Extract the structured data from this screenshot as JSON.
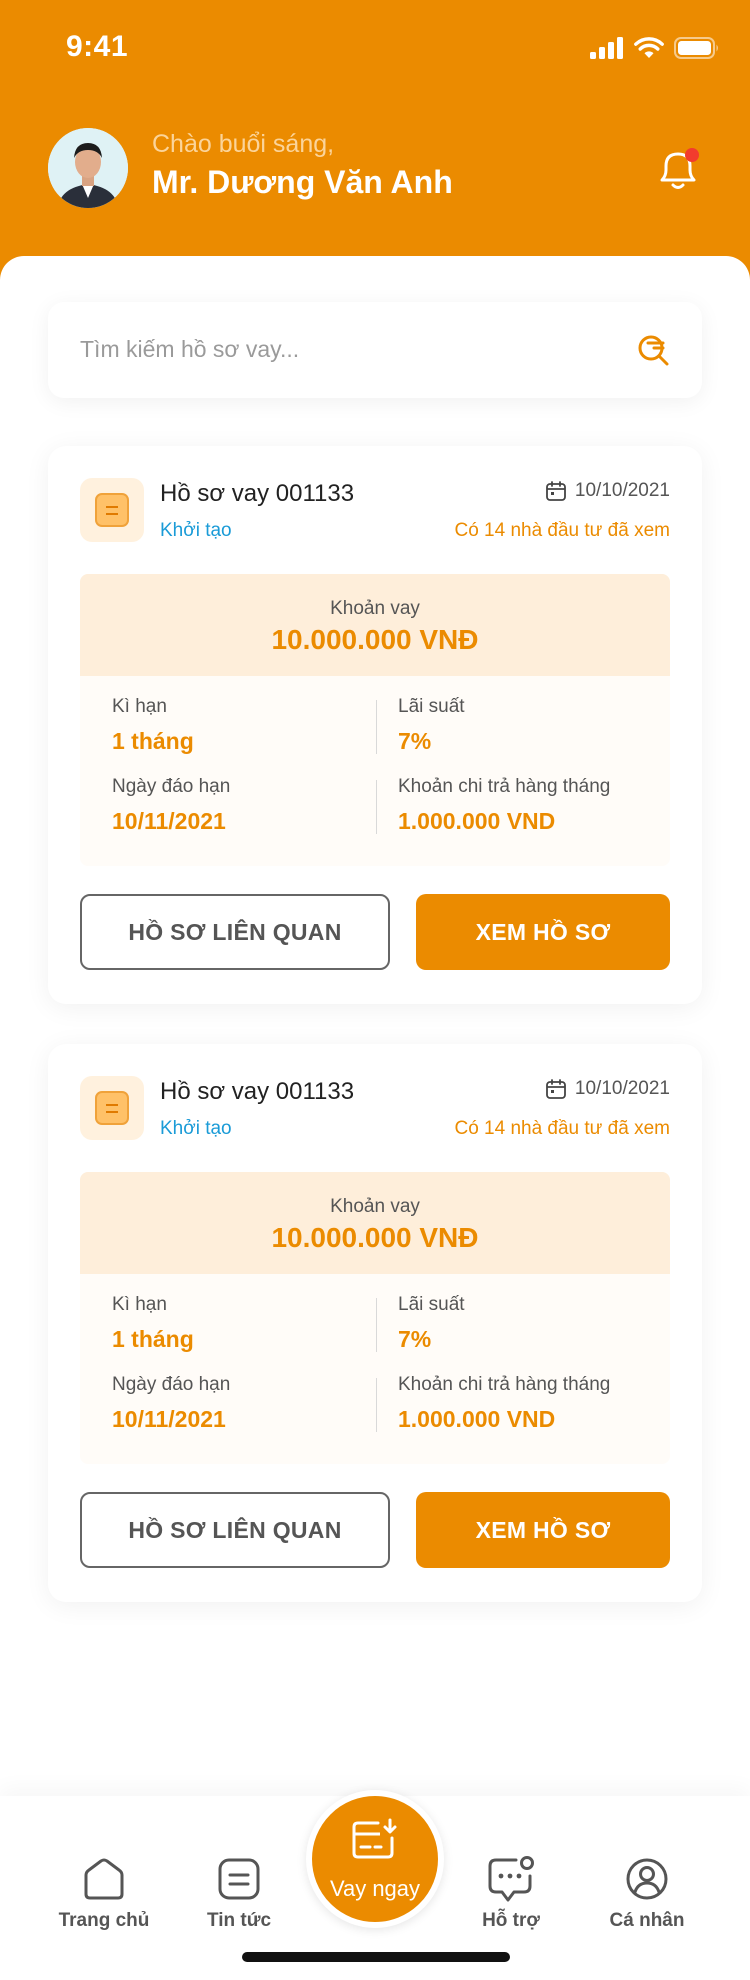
{
  "status_bar": {
    "time": "9:41"
  },
  "header": {
    "greeting": "Chào buổi sáng,",
    "user_name": "Mr. Dương Văn Anh"
  },
  "search": {
    "placeholder": "Tìm kiếm hồ sơ vay..."
  },
  "cards": [
    {
      "title": "Hồ sơ vay 001133",
      "status": "Khởi tạo",
      "date": "10/10/2021",
      "viewers": "Có 14 nhà đầu tư đã xem",
      "loan_label": "Khoản vay",
      "loan_amount": "10.000.000 VNĐ",
      "term_label": "Kì hạn",
      "term_value": "1 tháng",
      "rate_label": "Lãi suất",
      "rate_value": "7%",
      "maturity_label": "Ngày đáo hạn",
      "maturity_value": "10/11/2021",
      "monthly_label": "Khoản chi trả hàng tháng",
      "monthly_value": "1.000.000 VND",
      "related_button": "HỒ SƠ LIÊN QUAN",
      "view_button": "XEM HỒ SƠ"
    },
    {
      "title": "Hồ sơ vay 001133",
      "status": "Khởi tạo",
      "date": "10/10/2021",
      "viewers": "Có 14 nhà đầu tư đã xem",
      "loan_label": "Khoản vay",
      "loan_amount": "10.000.000 VNĐ",
      "term_label": "Kì hạn",
      "term_value": "1 tháng",
      "rate_label": "Lãi suất",
      "rate_value": "7%",
      "maturity_label": "Ngày đáo hạn",
      "maturity_value": "10/11/2021",
      "monthly_label": "Khoản chi trả hàng tháng",
      "monthly_value": "1.000.000 VND",
      "related_button": "HỒ SƠ LIÊN QUAN",
      "view_button": "XEM HỒ SƠ"
    }
  ],
  "tabbar": {
    "home": "Trang chủ",
    "news": "Tin tức",
    "borrow": "Vay ngay",
    "support": "Hỗ trợ",
    "profile": "Cá nhân"
  },
  "colors": {
    "primary": "#EB8B00",
    "status_link": "#1A9BD7",
    "loan_header_bg": "#FEEEDA",
    "notification_dot": "#F23B2E"
  },
  "icons": [
    "signal-icon",
    "wifi-icon",
    "battery-icon",
    "bell-icon",
    "search-icon",
    "calendar-icon",
    "document-icon",
    "home-icon",
    "news-icon",
    "loan-icon",
    "chat-icon",
    "user-icon"
  ]
}
